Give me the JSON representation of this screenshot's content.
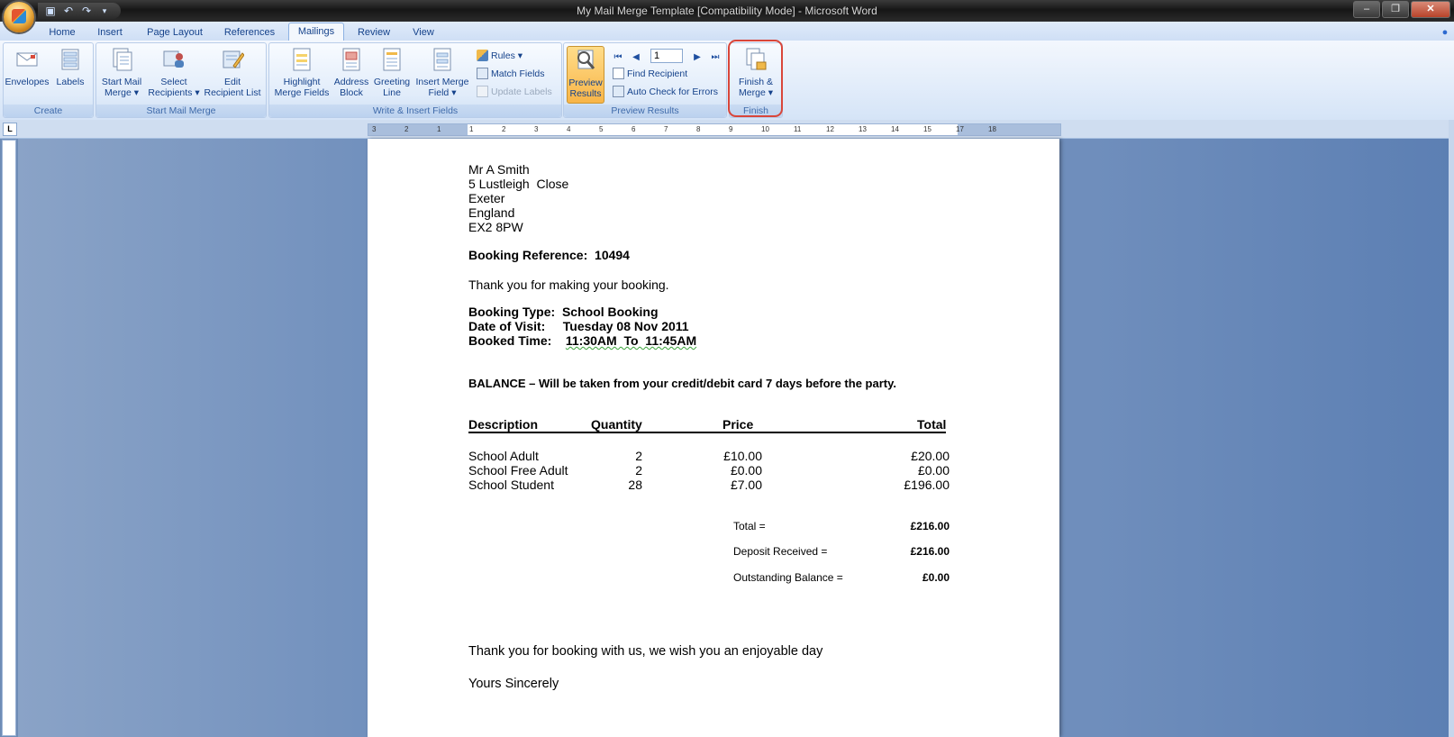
{
  "window": {
    "title": "My Mail Merge Template [Compatibility Mode] - Microsoft Word",
    "controls": [
      "minimize",
      "restore",
      "close"
    ]
  },
  "quick_access": [
    "save-icon",
    "undo-icon",
    "redo-icon"
  ],
  "tabs": [
    "Home",
    "Insert",
    "Page Layout",
    "References",
    "Mailings",
    "Review",
    "View"
  ],
  "active_tab": "Mailings",
  "ribbon": {
    "create": {
      "label": "Create",
      "envelopes": "Envelopes",
      "labels": "Labels"
    },
    "start": {
      "label": "Start Mail Merge",
      "start_l1": "Start Mail",
      "start_l2": "Merge ▾",
      "select_l1": "Select",
      "select_l2": "Recipients ▾",
      "edit_l1": "Edit",
      "edit_l2": "Recipient List"
    },
    "write": {
      "label": "Write & Insert Fields",
      "highlight_l1": "Highlight",
      "highlight_l2": "Merge Fields",
      "address_l1": "Address",
      "address_l2": "Block",
      "greeting_l1": "Greeting",
      "greeting_l2": "Line",
      "insert_l1": "Insert Merge",
      "insert_l2": "Field ▾",
      "rules": "Rules ▾",
      "match": "Match Fields",
      "update": "Update Labels"
    },
    "preview": {
      "label": "Preview Results",
      "preview_l1": "Preview",
      "preview_l2": "Results",
      "record": "1",
      "find": "Find Recipient",
      "auto": "Auto Check for Errors"
    },
    "finish": {
      "label": "Finish",
      "finish_l1": "Finish &",
      "finish_l2": "Merge ▾"
    }
  },
  "ruler_numbers": [
    "3",
    "2",
    "1",
    "1",
    "2",
    "3",
    "4",
    "5",
    "6",
    "7",
    "8",
    "9",
    "10",
    "11",
    "12",
    "13",
    "14",
    "15",
    "17",
    "18"
  ],
  "document": {
    "address": [
      "Mr A Smith",
      "5 Lustleigh  Close",
      "Exeter",
      "England",
      "EX2 8PW"
    ],
    "booking_ref": "Booking Reference:  10494",
    "thanks": "Thank you for making your booking.",
    "booking_type": "Booking Type:  School Booking",
    "date_of_visit": "Date of Visit:     Tuesday 08 Nov 2011",
    "booked_time_label": "Booked Time:    ",
    "booked_time_value": "11:30AM  To  11:45AM",
    "balance": "BALANCE – Will be taken from your credit/debit card 7 days before the party.",
    "table": {
      "headers": [
        "Description",
        "Quantity",
        "Price",
        "Total"
      ],
      "rows": [
        [
          "School Adult",
          "2",
          "£10.00",
          "£20.00"
        ],
        [
          "School Free Adult",
          "2",
          "£0.00",
          "£0.00"
        ],
        [
          "School Student",
          "28",
          "£7.00",
          "£196.00"
        ]
      ]
    },
    "totals": [
      [
        "Total =",
        "£216.00"
      ],
      [
        "Deposit Received =",
        "£216.00"
      ],
      [
        "Outstanding Balance =",
        "£0.00"
      ]
    ],
    "closing": "Thank you for booking with us, we wish you an enjoyable day",
    "signoff": "Yours Sincerely"
  }
}
